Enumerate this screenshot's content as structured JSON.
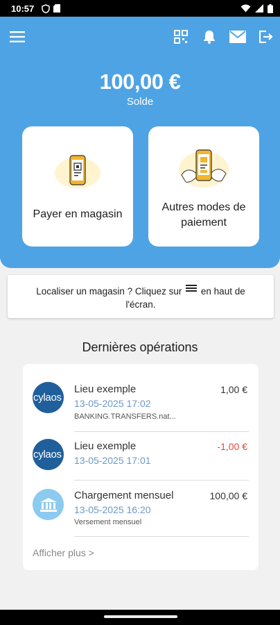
{
  "status_bar": {
    "time": "10:57"
  },
  "header": {
    "balance": "100,00 €",
    "balance_label": "Solde",
    "icons": [
      "menu-icon",
      "qr-code-icon",
      "bell-icon",
      "mail-icon",
      "logout-icon"
    ]
  },
  "actions": {
    "pay_in_store": "Payer en magasin",
    "other_payments_line1": "Autres modes de",
    "other_payments_line2": "paiement"
  },
  "info": {
    "text_before": "Localiser un magasin ? Cliquez sur",
    "text_after_line1": "en haut de",
    "text_line2": "l'écran."
  },
  "operations": {
    "title": "Dernières opérations",
    "items": [
      {
        "logo_text": "cylaos",
        "name": "Lieu exemple",
        "date": "13-05-2025 17:02",
        "sub": "BANKING.TRANSFERS.nat...",
        "amount": "1,00 €",
        "negative": false
      },
      {
        "logo_text": "cylaos",
        "name": "Lieu exemple",
        "date": "13-05-2025 17:01",
        "sub": "",
        "amount": "-1,00 €",
        "negative": true
      },
      {
        "logo_text": "",
        "name": "Chargement mensuel",
        "date": "13-05-2025 16:20",
        "sub": "Versement mensuel",
        "amount": "100,00 €",
        "negative": false
      }
    ],
    "show_more": "Afficher plus >"
  },
  "colors": {
    "primary": "#4ea3e4",
    "negative": "#e24a3a",
    "date": "#6b98c9"
  }
}
